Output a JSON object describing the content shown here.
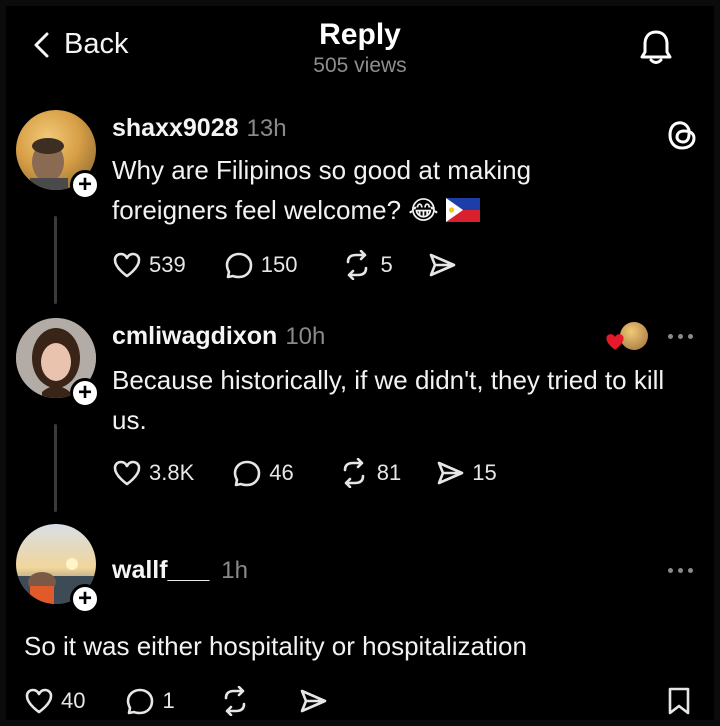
{
  "header": {
    "back_label": "Back",
    "title": "Reply",
    "views": "505 views"
  },
  "posts": [
    {
      "username": "shaxx9028",
      "time": "13h",
      "text": "Why are Filipinos so good at making foreigners feel welcome? 😂",
      "likes": "539",
      "replies": "150",
      "reposts": "5",
      "shares": ""
    },
    {
      "username": "cmliwagdixon",
      "time": "10h",
      "text": "Because historically, if we didn't, they tried to kill us.",
      "likes": "3.8K",
      "replies": "46",
      "reposts": "81",
      "shares": "15"
    },
    {
      "username": "wallf___",
      "time": "1h",
      "text": "So it was either hospitality or hospitalization",
      "likes": "40",
      "replies": "1",
      "reposts": "",
      "shares": ""
    }
  ],
  "colors": {
    "background": "#000000",
    "muted": "#8a8a8a",
    "like_heart": "#e5192a"
  },
  "icons": [
    "chevron-left-icon",
    "bell-icon",
    "threads-logo-icon",
    "heart-icon",
    "comment-icon",
    "repost-icon",
    "share-icon",
    "bookmark-icon",
    "plus-icon",
    "more-icon"
  ]
}
